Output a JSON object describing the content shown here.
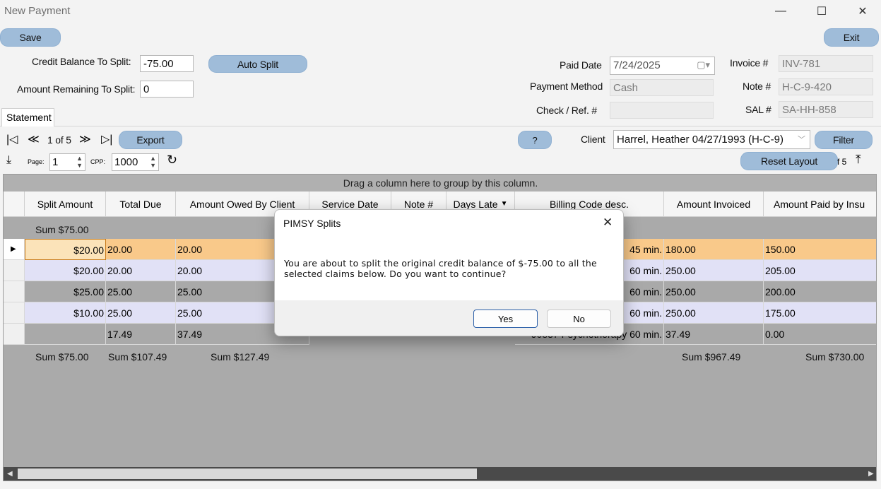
{
  "window": {
    "title": "New Payment",
    "minimize": "—",
    "maximize": "☐",
    "close": "✕"
  },
  "toolbar": {
    "save": "Save",
    "exit": "Exit"
  },
  "split": {
    "credit_label": "Credit Balance To Split:",
    "credit_value": "-75.00",
    "remaining_label": "Amount Remaining To Split:",
    "remaining_value": "0",
    "auto_split": "Auto Split"
  },
  "payment": {
    "paid_date_label": "Paid Date",
    "paid_date_value": "7/24/2025",
    "method_label": "Payment Method",
    "method_value": "Cash",
    "check_label": "Check / Ref. #",
    "check_value": "",
    "invoice_label": "Invoice #",
    "invoice_value": "INV-781",
    "note_label": "Note #",
    "note_value": "H-C-9-420",
    "sal_label": "SAL #",
    "sal_value": "SA-HH-858"
  },
  "tabs": {
    "statement": "Statement"
  },
  "pager": {
    "position": "1 of 5",
    "export": "Export",
    "page_label": "Page:",
    "page_value": "1",
    "cpp_label": "CPP:",
    "cpp_value": "1000",
    "client_label": "Client",
    "client_value": "Harrel, Heather  04/27/1993 (H-C-9)",
    "filter": "Filter",
    "reset_layout": "Reset Layout",
    "of_text": "f 5"
  },
  "grid": {
    "group_hint": "Drag a column here to group by this column.",
    "columns": [
      "Split Amount",
      "Total Due",
      "Amount Owed By Client",
      "Service Date",
      "Note #",
      "Days Late",
      "Billing Code desc.",
      "Amount Invoiced",
      "Amount Paid by Insu"
    ],
    "top_sum": "Sum $75.00",
    "rows": [
      {
        "split": "$20.00",
        "total": "20.00",
        "owed": "20.00",
        "billing": "45 min.",
        "invoiced": "180.00",
        "paid": "150.00"
      },
      {
        "split": "$20.00",
        "total": "20.00",
        "owed": "20.00",
        "billing": "60 min.",
        "invoiced": "250.00",
        "paid": "205.00"
      },
      {
        "split": "$25.00",
        "total": "25.00",
        "owed": "25.00",
        "billing": "60 min.",
        "invoiced": "250.00",
        "paid": "200.00"
      },
      {
        "split": "$10.00",
        "total": "25.00",
        "owed": "25.00",
        "billing": "60 min.",
        "invoiced": "250.00",
        "paid": "175.00"
      },
      {
        "split": "",
        "total": "17.49",
        "owed": "37.49",
        "billing": "90837 Psychotherapy 60 min.",
        "invoiced": "37.49",
        "paid": "0.00"
      }
    ],
    "sums": {
      "split": "Sum $75.00",
      "total": "Sum $107.49",
      "owed": "Sum $127.49",
      "invoiced": "Sum $967.49",
      "paid": "Sum $730.00"
    }
  },
  "dialog": {
    "title": "PIMSY Splits",
    "message": "You are about to split the original credit balance of $-75.00 to all the selected claims below.  Do you want to continue?",
    "yes": "Yes",
    "no": "No"
  },
  "colors": {
    "selected_row": "#f9c98a",
    "alt_row": "#e1e1f6",
    "grid_bg": "#aaaaaa",
    "button": "#9fbcd9"
  }
}
